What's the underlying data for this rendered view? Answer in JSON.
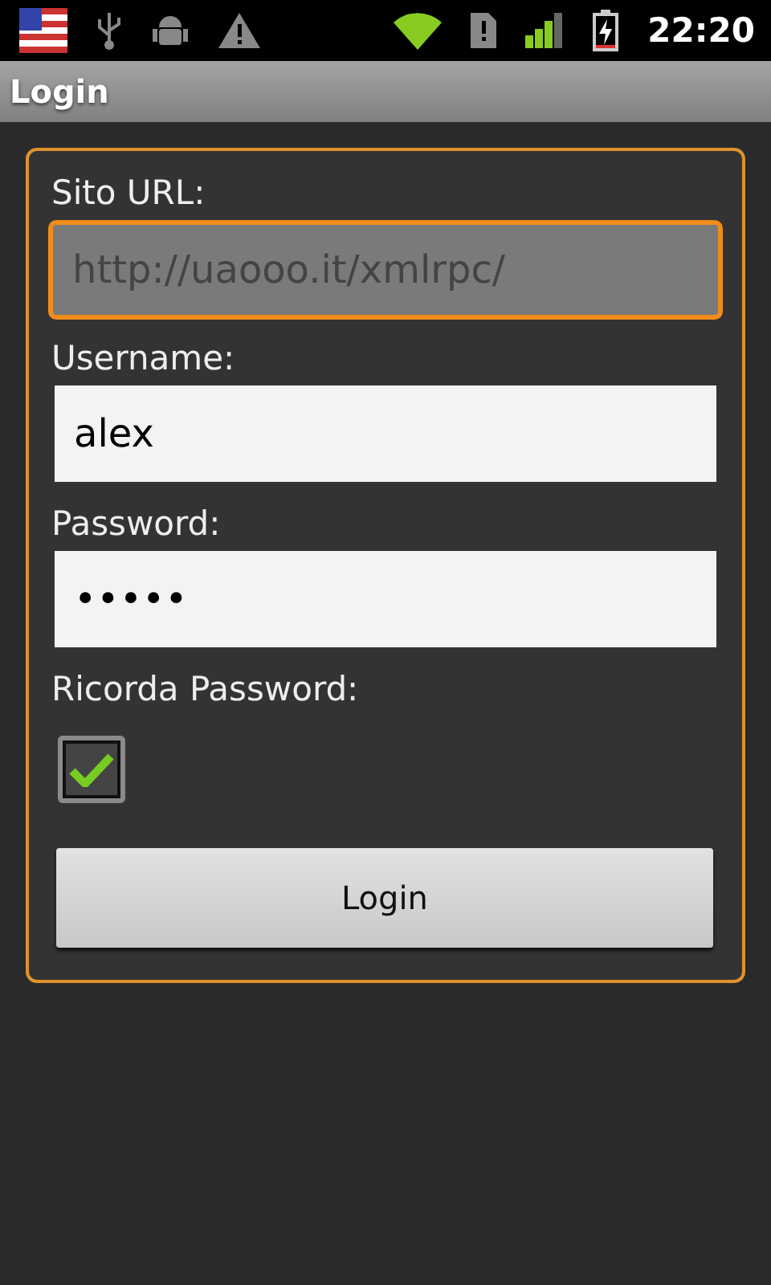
{
  "status_bar": {
    "time": "22:20"
  },
  "title_bar": {
    "title": "Login"
  },
  "form": {
    "fields": [
      {
        "label": "Sito URL:",
        "value": "http://uaooo.it/xmlrpc/",
        "focused": true,
        "disabled": true
      },
      {
        "label": "Username:",
        "value": "alex",
        "focused": false,
        "disabled": false
      },
      {
        "label": "Password:",
        "value": "•••••",
        "focused": false,
        "disabled": false
      }
    ],
    "remember": {
      "label": "Ricorda Password:",
      "checked": true
    },
    "button": "Login"
  }
}
